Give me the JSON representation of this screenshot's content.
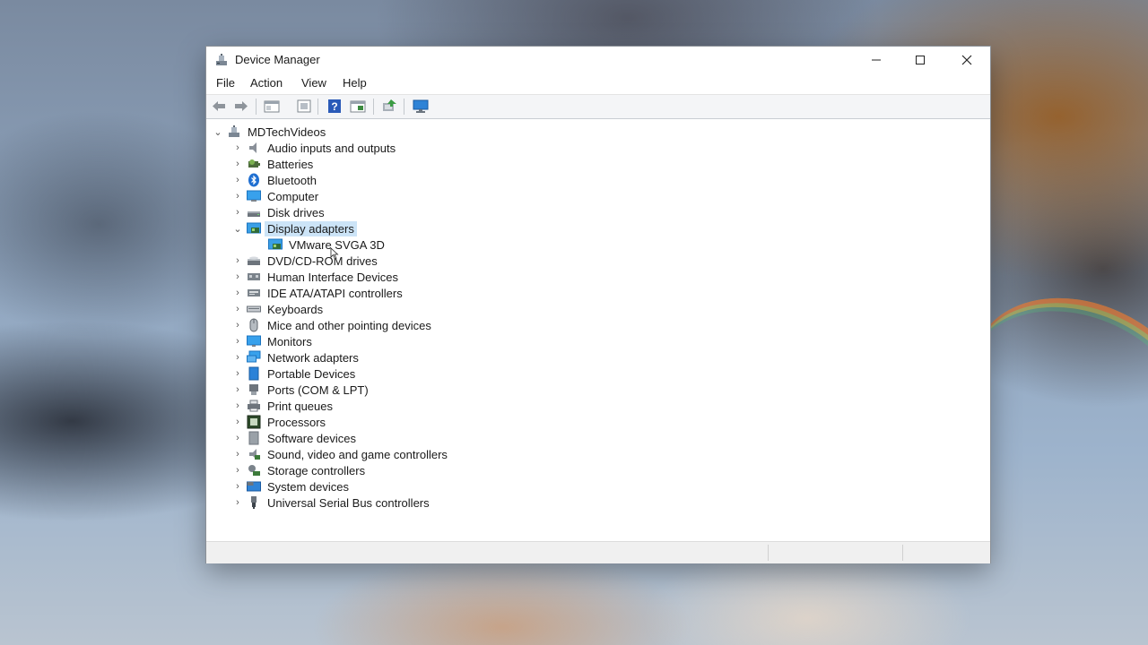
{
  "window": {
    "title": "Device Manager",
    "controls": {
      "minimize": "—",
      "maximize": "☐",
      "close": "✕"
    }
  },
  "menu": [
    "File",
    "Action",
    "View",
    "Help"
  ],
  "toolbar": {
    "buttons": [
      "back-icon",
      "forward-icon",
      "properties-pane-icon",
      "device-view-icon",
      "help-icon",
      "resources-view-icon",
      "update-driver-icon",
      "monitor-scan-icon"
    ]
  },
  "tree": {
    "root": "MDTechVideos",
    "categories": [
      {
        "label": "Audio inputs and outputs",
        "icon": "speaker-icon"
      },
      {
        "label": "Batteries",
        "icon": "battery-icon"
      },
      {
        "label": "Bluetooth",
        "icon": "bluetooth-icon"
      },
      {
        "label": "Computer",
        "icon": "computer-icon"
      },
      {
        "label": "Disk drives",
        "icon": "disk-drive-icon"
      },
      {
        "label": "Display adapters",
        "icon": "display-adapter-icon",
        "expanded": true,
        "selected": true,
        "children": [
          "VMware SVGA 3D"
        ]
      },
      {
        "label": "DVD/CD-ROM drives",
        "icon": "dvd-drive-icon"
      },
      {
        "label": "Human Interface Devices",
        "icon": "hid-icon"
      },
      {
        "label": "IDE ATA/ATAPI controllers",
        "icon": "ide-controller-icon"
      },
      {
        "label": "Keyboards",
        "icon": "keyboard-icon"
      },
      {
        "label": "Mice and other pointing devices",
        "icon": "mouse-icon"
      },
      {
        "label": "Monitors",
        "icon": "monitor-icon"
      },
      {
        "label": "Network adapters",
        "icon": "network-adapter-icon"
      },
      {
        "label": "Portable Devices",
        "icon": "portable-device-icon"
      },
      {
        "label": "Ports (COM & LPT)",
        "icon": "port-icon"
      },
      {
        "label": "Print queues",
        "icon": "printer-icon"
      },
      {
        "label": "Processors",
        "icon": "processor-icon"
      },
      {
        "label": "Software devices",
        "icon": "software-device-icon"
      },
      {
        "label": "Sound, video and game controllers",
        "icon": "sound-controller-icon"
      },
      {
        "label": "Storage controllers",
        "icon": "storage-controller-icon"
      },
      {
        "label": "System devices",
        "icon": "system-devices-icon"
      },
      {
        "label": "Universal Serial Bus controllers",
        "icon": "usb-icon"
      }
    ]
  },
  "colors": {
    "selection": "#cce4f7",
    "accent": "#2a78d4"
  }
}
